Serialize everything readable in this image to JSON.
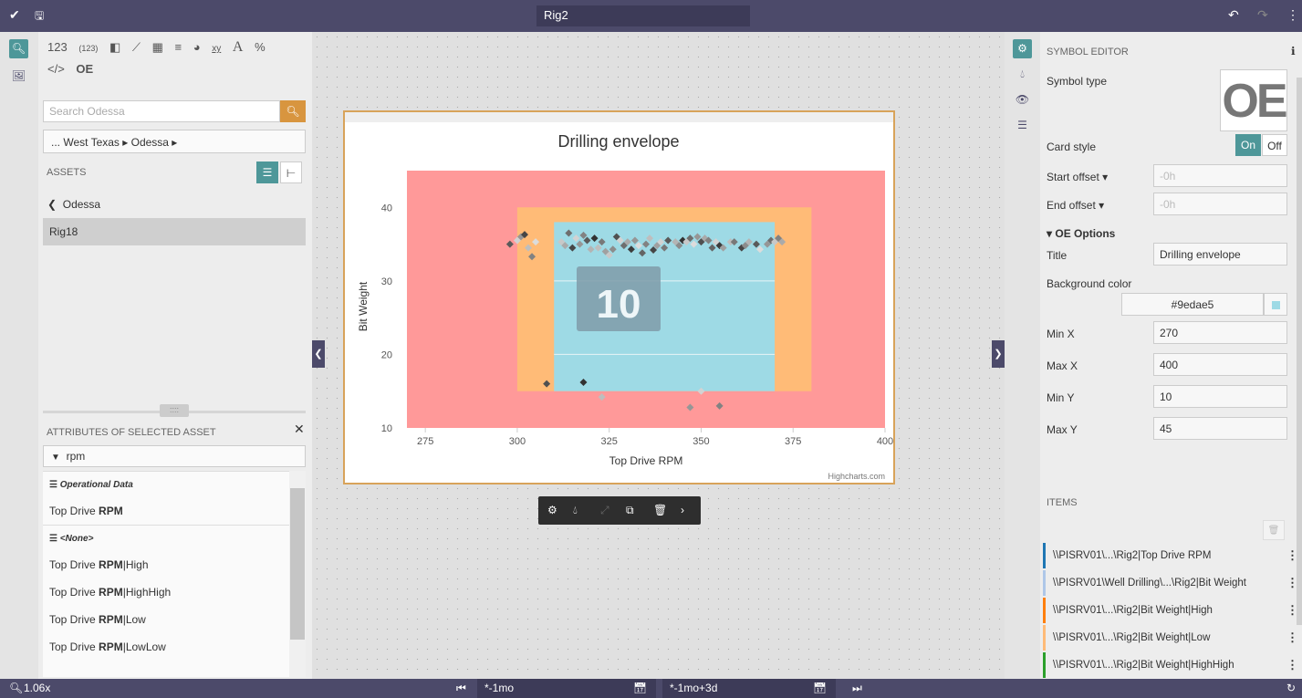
{
  "topbar": {
    "title": "Rig2"
  },
  "left": {
    "vis_icons": [
      "123",
      "(123)",
      "▮",
      "⟋",
      "▦",
      "≡",
      "◕",
      "xy",
      "A",
      "%",
      "</>",
      "OE"
    ],
    "search_placeholder": "Search Odessa",
    "breadcrumb": "... West Texas ▸ Odessa ▸",
    "assets_header": "ASSETS",
    "back_label": "Odessa",
    "asset_selected": "Rig18",
    "attrs_header": "ATTRIBUTES OF SELECTED ASSET",
    "filter_value": "rpm",
    "groups": [
      {
        "name": "Operational Data",
        "items": [
          {
            "pre": "Top Drive ",
            "bold": "RPM",
            "post": ""
          }
        ]
      },
      {
        "name": "<None>",
        "items": [
          {
            "pre": "Top Drive ",
            "bold": "RPM",
            "post": "|High"
          },
          {
            "pre": "Top Drive ",
            "bold": "RPM",
            "post": "|HighHigh"
          },
          {
            "pre": "Top Drive ",
            "bold": "RPM",
            "post": "|Low"
          },
          {
            "pre": "Top Drive ",
            "bold": "RPM",
            "post": "|LowLow"
          }
        ]
      }
    ]
  },
  "chart": {
    "title": "Drilling envelope",
    "xlabel": "Top Drive RPM",
    "ylabel": "Bit Weight",
    "credits": "Highcharts.com",
    "value_label": "10",
    "xticks": [
      "275",
      "300",
      "325",
      "350",
      "375",
      "400"
    ],
    "yticks": [
      "10",
      "20",
      "30",
      "40"
    ]
  },
  "chart_data": {
    "type": "scatter",
    "title": "Drilling envelope",
    "xlabel": "Top Drive RPM",
    "ylabel": "Bit Weight",
    "xlim": [
      270,
      400
    ],
    "ylim": [
      10,
      45
    ],
    "bands": [
      {
        "color": "#ff9999",
        "x": [
          270,
          400
        ],
        "y": [
          10,
          45
        ]
      },
      {
        "color": "#ffbb77",
        "x": [
          300,
          380
        ],
        "y": [
          15,
          40
        ]
      },
      {
        "color": "#9edae5",
        "x": [
          310,
          370
        ],
        "y": [
          15,
          38
        ]
      }
    ],
    "points": [
      [
        298,
        35
      ],
      [
        300,
        35.5
      ],
      [
        301,
        36
      ],
      [
        302,
        36.3
      ],
      [
        303,
        34.5
      ],
      [
        304,
        33.3
      ],
      [
        305,
        35.3
      ],
      [
        312,
        35.3
      ],
      [
        313,
        34.8
      ],
      [
        314,
        36.5
      ],
      [
        315,
        34.5
      ],
      [
        316,
        35.8
      ],
      [
        317,
        35
      ],
      [
        318,
        36.2
      ],
      [
        319,
        35.5
      ],
      [
        320,
        34.3
      ],
      [
        321,
        35.8
      ],
      [
        322,
        34.5
      ],
      [
        323,
        35.3
      ],
      [
        324,
        34
      ],
      [
        325,
        33.5
      ],
      [
        326,
        34.3
      ],
      [
        327,
        36
      ],
      [
        328,
        35.5
      ],
      [
        329,
        34.8
      ],
      [
        330,
        35.3
      ],
      [
        331,
        34.3
      ],
      [
        332,
        35.5
      ],
      [
        333,
        34.8
      ],
      [
        334,
        33.8
      ],
      [
        335,
        35
      ],
      [
        336,
        35.8
      ],
      [
        337,
        34.2
      ],
      [
        338,
        34.8
      ],
      [
        339,
        35.3
      ],
      [
        340,
        34.5
      ],
      [
        341,
        35.5
      ],
      [
        343,
        35.3
      ],
      [
        344,
        34.8
      ],
      [
        345,
        35.5
      ],
      [
        346,
        35.3
      ],
      [
        347,
        35.8
      ],
      [
        348,
        35
      ],
      [
        349,
        36
      ],
      [
        350,
        35.3
      ],
      [
        351,
        35.8
      ],
      [
        352,
        35.5
      ],
      [
        353,
        34.5
      ],
      [
        354,
        35.3
      ],
      [
        355,
        34.8
      ],
      [
        356,
        34.5
      ],
      [
        358,
        35.3
      ],
      [
        359,
        35.3
      ],
      [
        361,
        34.5
      ],
      [
        362,
        34.8
      ],
      [
        363,
        35.3
      ],
      [
        365,
        35
      ],
      [
        366,
        34.3
      ],
      [
        368,
        35
      ],
      [
        369,
        35.5
      ],
      [
        370,
        35.3
      ],
      [
        371,
        35.8
      ],
      [
        372,
        35.3
      ],
      [
        308,
        16
      ],
      [
        318,
        16.2
      ],
      [
        323,
        14.2
      ],
      [
        347,
        12.8
      ],
      [
        350,
        15
      ],
      [
        355,
        13
      ]
    ],
    "point_values": [
      0.3,
      0.9,
      0.6,
      0.2,
      0.8,
      0.5,
      0.95,
      0.85,
      0.7,
      0.4,
      0.2,
      0.9,
      0.6,
      0.5,
      0.3,
      0.75,
      0.1,
      0.8,
      0.45,
      0.65,
      0.85,
      0.55,
      0.25,
      0.9,
      0.4,
      0.7,
      0.15,
      0.6,
      0.95,
      0.35,
      0.5,
      0.8,
      0.2,
      0.65,
      0.9,
      0.45,
      0.3,
      0.75,
      0.55,
      0.1,
      0.85,
      0.4,
      0.95,
      0.6,
      0.25,
      0.7,
      0.5,
      0.35,
      0.9,
      0.15,
      0.65,
      0.8,
      0.45,
      0.2,
      0.55,
      0.75,
      0.3,
      0.95,
      0.6,
      0.4,
      0.85,
      0.5,
      0.7,
      0.25,
      0.1,
      0.8,
      0.6,
      0.9,
      0.5,
      0.3
    ],
    "grid_y": [
      20,
      30
    ]
  },
  "right": {
    "header": "SYMBOL EDITOR",
    "symbol_type_label": "Symbol type",
    "symbol_glyph": "OE",
    "card_style_label": "Card style",
    "toggle_on": "On",
    "toggle_off": "Off",
    "start_offset_label": "Start offset ▾",
    "start_offset_placeholder": "-0h",
    "end_offset_label": "End offset ▾",
    "end_offset_placeholder": "-0h",
    "options_header": "▾  OE Options",
    "title_label": "Title",
    "title_value": "Drilling envelope",
    "bg_label": "Background color",
    "bg_value": "#9edae5",
    "minx_label": "Min X",
    "minx": "270",
    "maxx_label": "Max X",
    "maxx": "400",
    "miny_label": "Min Y",
    "miny": "10",
    "maxy_label": "Max Y",
    "maxy": "45",
    "items_header": "ITEMS",
    "items": [
      {
        "text": "\\\\PISRV01\\...\\Rig2|Top Drive RPM",
        "color": "#1f77b4"
      },
      {
        "text": "\\\\PISRV01\\Well Drilling\\...\\Rig2|Bit Weight",
        "color": "#aec7e8"
      },
      {
        "text": "\\\\PISRV01\\...\\Rig2|Bit Weight|High",
        "color": "#ff7f0e"
      },
      {
        "text": "\\\\PISRV01\\...\\Rig2|Bit Weight|Low",
        "color": "#ffbb78"
      },
      {
        "text": "\\\\PISRV01\\...\\Rig2|Bit Weight|HighHigh",
        "color": "#2ca02c"
      }
    ]
  },
  "bottom": {
    "zoom": "1.06x",
    "start_time": "*-1mo",
    "end_time": "*-1mo+3d"
  }
}
